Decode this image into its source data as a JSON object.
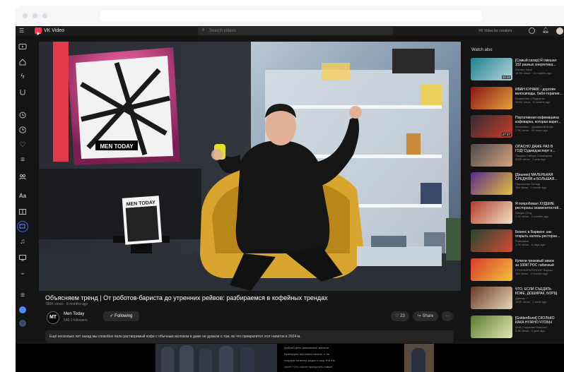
{
  "app": {
    "name": "VK Video",
    "search_placeholder": "Search videos",
    "topright_text": "VK Video for creators"
  },
  "video": {
    "title": "Объясняем тренд | От роботов-бариста до утренних рейвов: разбираемся в кофейных трендах",
    "meta": "780K views · 8 months ago",
    "channel": "Men Today",
    "subscribers": "540.1 followers",
    "avatar_text": "MT",
    "follow_label": "Following",
    "likes": "23",
    "share_label": "Share",
    "more_label": "···",
    "description": "Ещё несколько лет назад мы спокойно пили растворимый кофе с обычным молоком и даже не думали о том, во что превратится этот напиток в 2024-м.",
    "set_sign": "MEN TODAY",
    "magazine_title": "MEN TODAY"
  },
  "sidebar_icons": [
    "video-icon",
    "home-icon",
    "lightning-icon",
    "clips-icon",
    "history-icon",
    "clock-icon",
    "heart-icon",
    "playlist-icon",
    "groups-icon",
    "channel-icon",
    "catalog-icon",
    "tv-icon",
    "music-icon",
    "screen-icon",
    "chevron-down-icon",
    "queue-icon",
    "avatar-blue-icon",
    "logo-icon"
  ],
  "watch_also": "Watch also",
  "recommendations": [
    {
      "title": "[Самый сахар] Я смешал",
      "title2": "152 разных энергетика...",
      "meta": "Gordon Sami",
      "meta2": "14.9K views · 11 months ago",
      "duration": "20:40",
      "c1": "#1f7f8e",
      "c2": "#b6d7dc"
    },
    {
      "title": "ИВАН КУНАКК - дорогие",
      "title2": "велосипеды, бабл-терапия...",
      "meta": "Бешенство | Подкасты",
      "meta2": "20.5K views · 8 months ago",
      "duration": "",
      "c1": "#8a1616",
      "c2": "#e2a33c"
    },
    {
      "title": "Портативная кофемашина",
      "title2": "кофеварка, которая варит...",
      "meta": "Informatics · Домашний Кофе",
      "meta2": "7.9K views · 10 hours ago",
      "duration": "27:47",
      "c1": "#2f2f2f",
      "c2": "#ce3a2b"
    },
    {
      "title": "ОПАСНО ДАЖЕ РАЗ В",
      "title2": "ГОД! Судмедэксперт о...",
      "meta": "Пацаны Сибирь Семинарии",
      "meta2": "202K views · 1 year ago",
      "duration": "",
      "c1": "#4b4b4b",
      "c2": "#d7a17e"
    },
    {
      "title": "[Дешево] МАЛЕНЬКАЯ",
      "title2": "СРЕДНЯЯ и БОЛЬШАЯ...",
      "meta": "Пиршество Gunsgr",
      "meta2": "15K views · 1 month ago",
      "duration": "",
      "c1": "#572a8e",
      "c2": "#e3c23a"
    },
    {
      "title": "Я попробовал ХУДШИЕ",
      "title2": "рестораны знаменитостей...",
      "meta": "Slavjan Oreg",
      "meta2": "2.1K views · 2 months ago",
      "duration": "",
      "c1": "#b33b2d",
      "c2": "#f0e2c6"
    },
    {
      "title": "Бизнес в Барвихе: как",
      "title2": "открыть халяль-ресторан...",
      "meta": "Probuiskai",
      "meta2": "1.2K views · 5 days ago",
      "duration": "",
      "c1": "#27452f",
      "c2": "#d24b38"
    },
    {
      "title": "Купили тризовый замок",
      "title2": "за 100К! РОС табачный",
      "meta": "HOOKAHPATENHOF Фирмы",
      "meta2": "16K views · 2 months ago",
      "duration": "",
      "c1": "#d93a2a",
      "c2": "#f2c33c"
    },
    {
      "title": "ЧТО, ЕСЛИ СЪЕДАТЬ",
      "title2": "КОФЕ, ДОШИРАК, БОРЩ",
      "meta": "Данияр ✓",
      "meta2": "184K views · 1 week ago",
      "duration": "",
      "c1": "#6b3a2a",
      "c2": "#e7d6b8"
    },
    {
      "title": "[GoldenBurst] СКОЛЬКО",
      "title2": "КАКА НУЖНО ЧТОБЫ",
      "meta": "Мой | Хорошие Новости",
      "meta2": "3.4K views · 1 year ago",
      "duration": "",
      "c1": "#5a7a2e",
      "c2": "#e3e6b3"
    }
  ],
  "bottom_text_lines": [
    "Добрый день уважаемые зрители",
    "Бронируем на нашем канале, и не",
    "спорили на вечер радио и шоу. Кто это",
    "хочет? Что она не пропустить новые"
  ]
}
